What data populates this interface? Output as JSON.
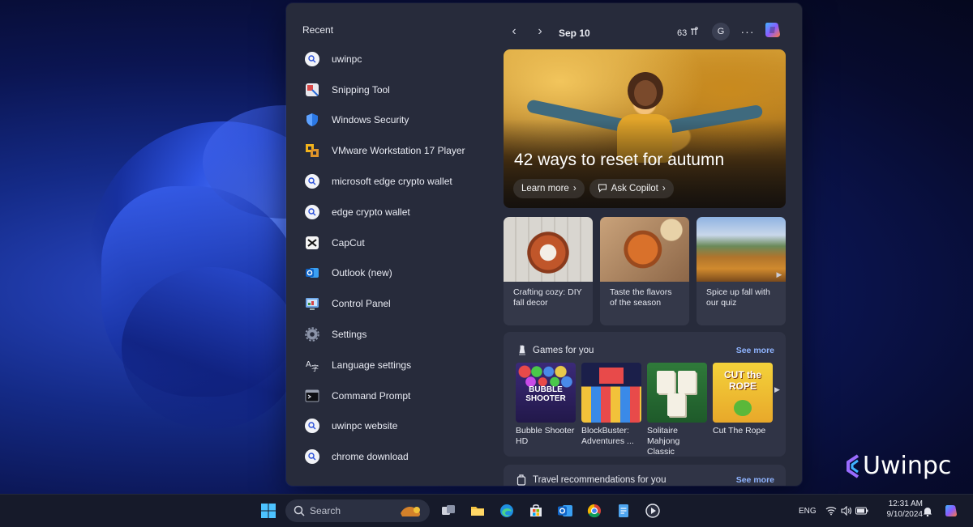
{
  "widgets": {
    "recent_title": "Recent",
    "recent_items": [
      {
        "label": "uwinpc",
        "icon": "search-icon"
      },
      {
        "label": "Snipping Tool",
        "icon": "snipping-tool-icon"
      },
      {
        "label": "Windows Security",
        "icon": "windows-security-shield-icon"
      },
      {
        "label": "VMware Workstation 17 Player",
        "icon": "vmware-icon"
      },
      {
        "label": "microsoft edge crypto wallet",
        "icon": "search-icon"
      },
      {
        "label": "edge crypto wallet",
        "icon": "search-icon"
      },
      {
        "label": "CapCut",
        "icon": "capcut-icon"
      },
      {
        "label": "Outlook (new)",
        "icon": "outlook-icon"
      },
      {
        "label": "Control Panel",
        "icon": "control-panel-icon"
      },
      {
        "label": "Settings",
        "icon": "settings-gear-icon"
      },
      {
        "label": "Language settings",
        "icon": "language-settings-icon"
      },
      {
        "label": "Command Prompt",
        "icon": "command-prompt-icon"
      },
      {
        "label": "uwinpc website",
        "icon": "search-icon"
      },
      {
        "label": "chrome download",
        "icon": "search-icon"
      }
    ],
    "header": {
      "date": "Sep 10",
      "weather_temp": "63",
      "avatar_letter": "G",
      "more_label": "···"
    },
    "hero": {
      "title": "42 ways to reset for autumn",
      "learn_more": "Learn more",
      "ask_copilot": "Ask Copilot"
    },
    "cards": [
      {
        "text": "Crafting cozy: DIY fall decor"
      },
      {
        "text": "Taste the flavors of the season"
      },
      {
        "text": "Spice up fall with our quiz"
      }
    ],
    "games": {
      "title": "Games for you",
      "see_more": "See more",
      "items": [
        {
          "name": "Bubble Shooter HD",
          "art_text": "BUBBLE SHOOTER"
        },
        {
          "name": "BlockBuster: Adventures ...",
          "art_text": ""
        },
        {
          "name": "Solitaire Mahjong Classic",
          "art_text": ""
        },
        {
          "name": "Cut The Rope",
          "art_text": "CUT the ROPE"
        }
      ]
    },
    "travel": {
      "title": "Travel recommendations for you",
      "see_more": "See more"
    }
  },
  "brand": {
    "text": "Uwinpc"
  },
  "taskbar": {
    "search_placeholder": "Search",
    "language": "ENG",
    "time": "12:31 AM",
    "date": "9/10/2024"
  },
  "colors": {
    "panel_bg": "#272b3b",
    "accent_link": "#8fb4ff",
    "taskbar_bg": "#161a2a"
  }
}
